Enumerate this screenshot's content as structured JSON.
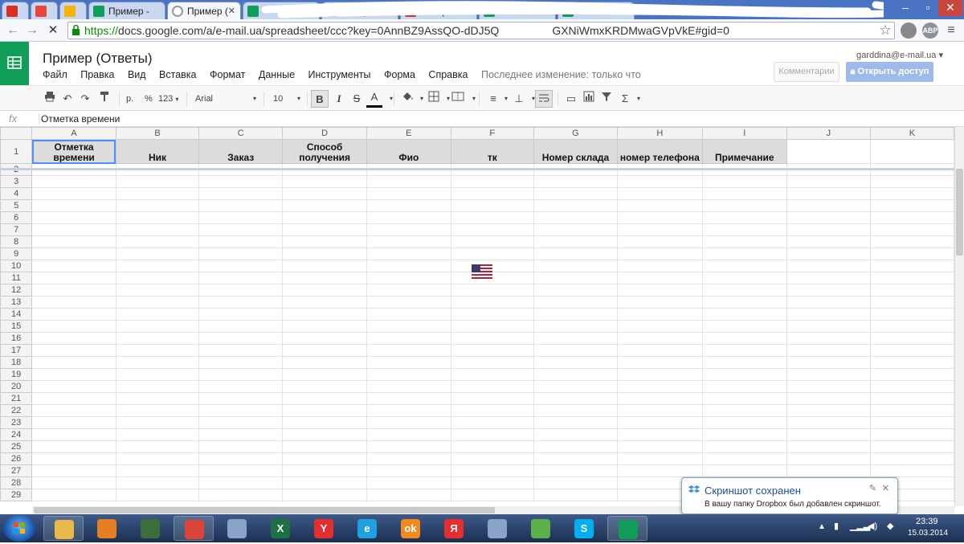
{
  "browser": {
    "tabs": [
      {
        "label": "",
        "favicon": "gmail-icon",
        "color": "#d93025",
        "active": false
      },
      {
        "label": "",
        "favicon": "calendar-icon",
        "color": "#e8453c",
        "active": false
      },
      {
        "label": "",
        "favicon": "drive-icon",
        "color": "#f4b400",
        "active": false
      },
      {
        "label": "Пример -",
        "favicon": "sheets-icon",
        "color": "#0f9d58",
        "active": false
      },
      {
        "label": "Пример (",
        "favicon": "loading-icon",
        "color": "#999999",
        "active": true
      },
      {
        "label": "",
        "favicon": "sheets-icon",
        "color": "#0f9d58",
        "active": false
      },
      {
        "label": "AliExpress",
        "favicon": "cart-icon",
        "color": "#d32f2f",
        "active": false
      },
      {
        "label": "AliExpress",
        "favicon": "cart-icon",
        "color": "#d32f2f",
        "active": false
      },
      {
        "label": "",
        "favicon": "sheets-icon",
        "color": "#0f9d58",
        "active": false
      },
      {
        "label": "",
        "favicon": "sheets-icon",
        "color": "#0f9d58",
        "active": false
      }
    ],
    "url_scheme": "https://",
    "url_rest": "docs.google.com/a/e-mail.ua/spreadsheet/ccc?key=0AnnBZ9AssQO-dDJ5Q",
    "url_tail": "GXNiWmxKRDMwaGVpVkE#gid=0",
    "ext_abp": "ABP"
  },
  "doc": {
    "title": "Пример (Ответы)",
    "menu": [
      "Файл",
      "Правка",
      "Вид",
      "Вставка",
      "Формат",
      "Данные",
      "Инструменты",
      "Форма",
      "Справка"
    ],
    "last_edit": "Последнее изменение: только что",
    "user_email": "garddina@e-mail.ua",
    "comments_label": "Комментарии",
    "share_label": "Открыть доступ"
  },
  "toolbar": {
    "currency": "р.",
    "percent": "%",
    "number_format": "123",
    "font": "Arial",
    "font_size": "10",
    "bold": "B",
    "italic": "I",
    "strike": "S",
    "text_color": "A",
    "sum": "Σ"
  },
  "formula": {
    "fx": "fx",
    "content": "Отметка времени"
  },
  "sheet": {
    "columns": [
      "A",
      "B",
      "C",
      "D",
      "E",
      "F",
      "G",
      "H",
      "I",
      "J",
      "K"
    ],
    "header_row": [
      "Отметка времени",
      "Ник",
      "Заказ",
      "Способ получения",
      "Фио",
      "тк",
      "Номер склада",
      "номер телефона",
      "Примечание",
      "",
      ""
    ],
    "row_numbers": [
      "1",
      "2",
      "3",
      "4",
      "5",
      "6",
      "7",
      "8",
      "9",
      "10",
      "11",
      "12",
      "13",
      "14",
      "15",
      "16",
      "17",
      "18",
      "19",
      "20",
      "21",
      "22",
      "23",
      "24",
      "25",
      "26",
      "27",
      "28",
      "29"
    ]
  },
  "notification": {
    "title": "Скриншот сохранен",
    "body": "В вашу папку Dropbox был добавлен скриншот."
  },
  "clock": {
    "time": "23:39",
    "date": "15.03.2014"
  },
  "taskbar": {
    "apps": [
      {
        "name": "explorer-icon",
        "color": "#e8b84a",
        "open": true
      },
      {
        "name": "media-player-icon",
        "color": "#e67e22",
        "open": false
      },
      {
        "name": "terminal-icon",
        "color": "#3c6e3c",
        "open": false
      },
      {
        "name": "chrome-icon",
        "color": "#db4437",
        "open": true
      },
      {
        "name": "calculator-icon",
        "color": "#8aa2c8",
        "open": false
      },
      {
        "name": "excel-icon",
        "color": "#1e7145",
        "open": false
      },
      {
        "name": "yandex-browser-icon",
        "color": "#e62e2e",
        "open": false
      },
      {
        "name": "ie-icon",
        "color": "#1ea1e0",
        "open": false
      },
      {
        "name": "odnoklassniki-icon",
        "color": "#f28a1d",
        "open": false
      },
      {
        "name": "yandex-icon",
        "color": "#e62e2e",
        "open": false
      },
      {
        "name": "speaker-app-icon",
        "color": "#8aa2c8",
        "open": false
      },
      {
        "name": "launcher-icon",
        "color": "#5bb14a",
        "open": false
      },
      {
        "name": "skype-icon",
        "color": "#00aff0",
        "open": false
      },
      {
        "name": "sheets-app-icon",
        "color": "#0f9d58",
        "open": true
      }
    ],
    "app_glyphs": [
      "",
      "",
      "",
      "",
      "",
      "X",
      "Y",
      "e",
      "ok",
      "Я",
      "",
      "",
      "S",
      ""
    ]
  }
}
